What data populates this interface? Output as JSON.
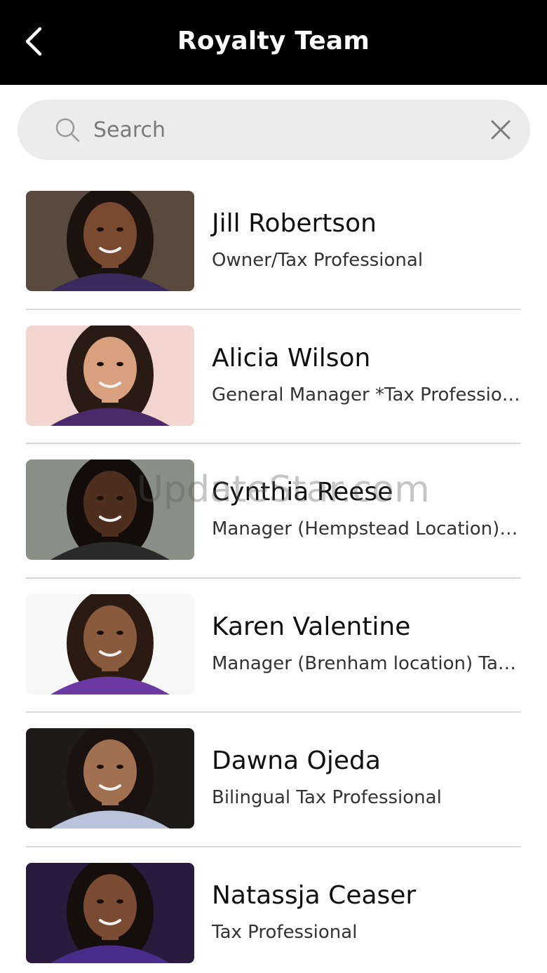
{
  "header": {
    "title": "Royalty Team",
    "back_icon": "chevron-left-icon"
  },
  "search": {
    "placeholder": "Search",
    "value": "",
    "search_icon": "search-icon",
    "clear_icon": "close-icon"
  },
  "team": [
    {
      "name": "Jill Robertson",
      "role": "Owner/Tax Professional",
      "photo": {
        "bg": "#5a4a3e",
        "skin": "#7a4a30",
        "hair": "#1c120e",
        "shirt": "#3a2a5e"
      }
    },
    {
      "name": "Alicia Wilson",
      "role": "General Manager *Tax Professional",
      "photo": {
        "bg": "#f2d5cf",
        "skin": "#d9a07e",
        "hair": "#2a1a14",
        "shirt": "#4a2a6a"
      }
    },
    {
      "name": "Cynthia Reese",
      "role": "Manager (Hempstead Location) Tax Professional",
      "photo": {
        "bg": "#8a8f86",
        "skin": "#4e2e1e",
        "hair": "#120c0a",
        "shirt": "#2a2a2a"
      }
    },
    {
      "name": "Karen Valentine",
      "role": "Manager (Brenham location) Tax Professional",
      "photo": {
        "bg": "#f7f7f7",
        "skin": "#8a5a3e",
        "hair": "#2a1a12",
        "shirt": "#6a3aa2"
      }
    },
    {
      "name": "Dawna Ojeda",
      "role": "Bilingual Tax Professional",
      "photo": {
        "bg": "#1e1a1a",
        "skin": "#a07050",
        "hair": "#1a1210",
        "shirt": "#b8c2d8"
      }
    },
    {
      "name": "Natassja Ceaser",
      "role": "Tax Professional",
      "photo": {
        "bg": "#2a1a3e",
        "skin": "#7a4a32",
        "hair": "#140e0c",
        "shirt": "#4a2c8a"
      }
    }
  ],
  "watermark": "UpdateStar.com"
}
